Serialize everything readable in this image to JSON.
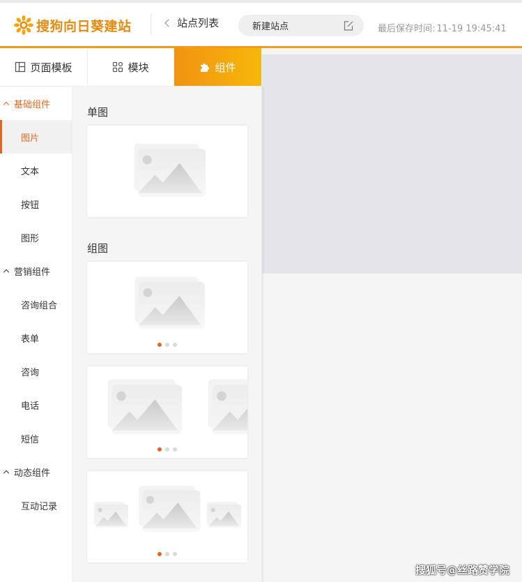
{
  "header": {
    "logo_text": "搜狗向日葵建站",
    "back_label": "站点列表",
    "site_name": "新建站点",
    "save_label": "最后保存时间:",
    "save_time": "11-19 19:45:41"
  },
  "tabs": [
    {
      "label": "页面模板",
      "icon": "template-icon"
    },
    {
      "label": "模块",
      "icon": "module-grid-icon"
    },
    {
      "label": "组件",
      "icon": "puzzle-icon",
      "active": true
    }
  ],
  "sidebar": {
    "groups": [
      {
        "label": "基础组件",
        "items": [
          "图片",
          "文本",
          "按钮",
          "图形"
        ]
      },
      {
        "label": "营销组件",
        "items": [
          "咨询组合",
          "表单",
          "咨询",
          "电话",
          "短信"
        ]
      },
      {
        "label": "动态组件",
        "items": [
          "互动记录"
        ]
      }
    ],
    "active_item": "图片"
  },
  "panel": {
    "single_title": "单图",
    "group_title": "组图"
  },
  "colors": {
    "accent": "#e0681e",
    "tab_gradient_start": "#f29212",
    "tab_gradient_end": "#f6b80a",
    "logo": "#e58b0f"
  },
  "watermark": "搜狐号@丝路赞学院"
}
